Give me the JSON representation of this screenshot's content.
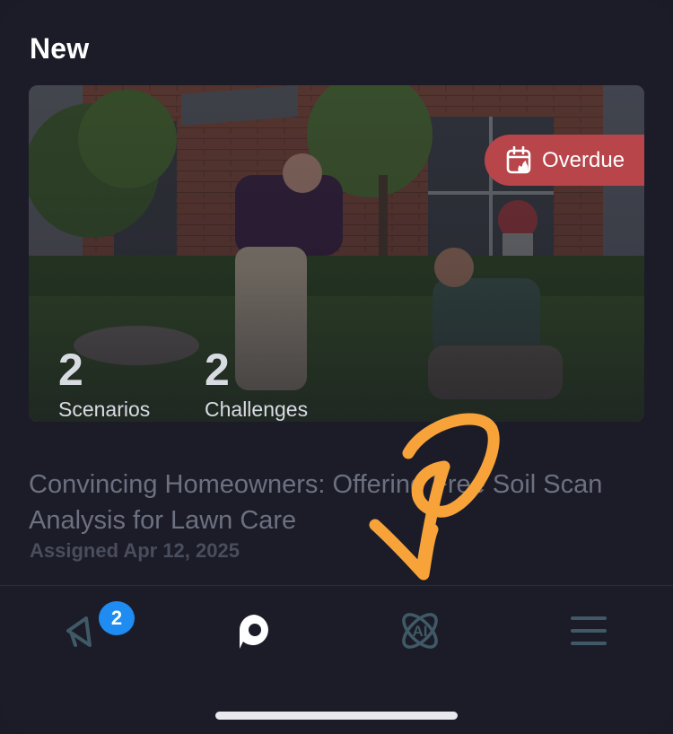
{
  "section": {
    "title": "New"
  },
  "card": {
    "badge_label": "Overdue",
    "stats": [
      {
        "value": "2",
        "label": "Scenarios"
      },
      {
        "value": "2",
        "label": "Challenges"
      }
    ],
    "title": "Convincing Homeowners: Offering Free Soil Scan Analysis for Lawn Care",
    "assigned": "Assigned Apr 12, 2025"
  },
  "nav": {
    "items": [
      {
        "icon": "megaphone-icon",
        "badge": "2"
      },
      {
        "icon": "chat-bubble-icon"
      },
      {
        "icon": "ai-atom-icon"
      },
      {
        "icon": "menu-icon"
      }
    ]
  },
  "colors": {
    "background": "#1b1c28",
    "overdue": "#b7454a",
    "badge": "#1f8cf2",
    "annotation_arrow": "#f7a33a"
  }
}
